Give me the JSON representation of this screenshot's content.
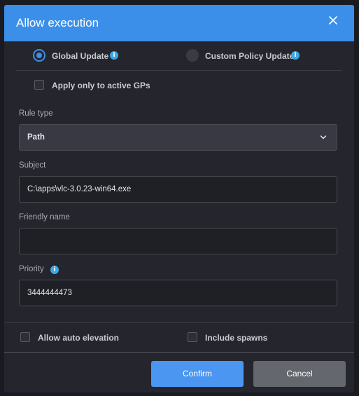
{
  "dialog": {
    "title": "Allow execution",
    "close_icon": "close-icon"
  },
  "update_mode": {
    "options": [
      {
        "label": "Global Update",
        "selected": true,
        "info_icon": "i"
      },
      {
        "label": "Custom Policy Update",
        "selected": false,
        "info_icon": "i"
      }
    ]
  },
  "apply_active": {
    "label": "Apply only to active GPs",
    "checked": false
  },
  "rule_type": {
    "label": "Rule type",
    "value": "Path",
    "icon": "chevron-down-icon"
  },
  "subject": {
    "label": "Subject",
    "value": "C:\\apps\\vlc-3.0.23-win64.exe"
  },
  "friendly_name": {
    "label": "Friendly name",
    "value": ""
  },
  "priority": {
    "label": "Priority",
    "value": "3444444473",
    "info_icon": "i"
  },
  "options": {
    "auto_elevation": {
      "label": "Allow auto elevation",
      "checked": false
    },
    "include_spawns": {
      "label": "Include spawns",
      "checked": false
    }
  },
  "buttons": {
    "confirm": "Confirm",
    "cancel": "Cancel"
  },
  "colors": {
    "header": "#3c8fe8",
    "panel": "#25262d",
    "confirm_button": "#4a96f0",
    "cancel_button": "#65676e",
    "info_badge": "#3aa9e8"
  }
}
